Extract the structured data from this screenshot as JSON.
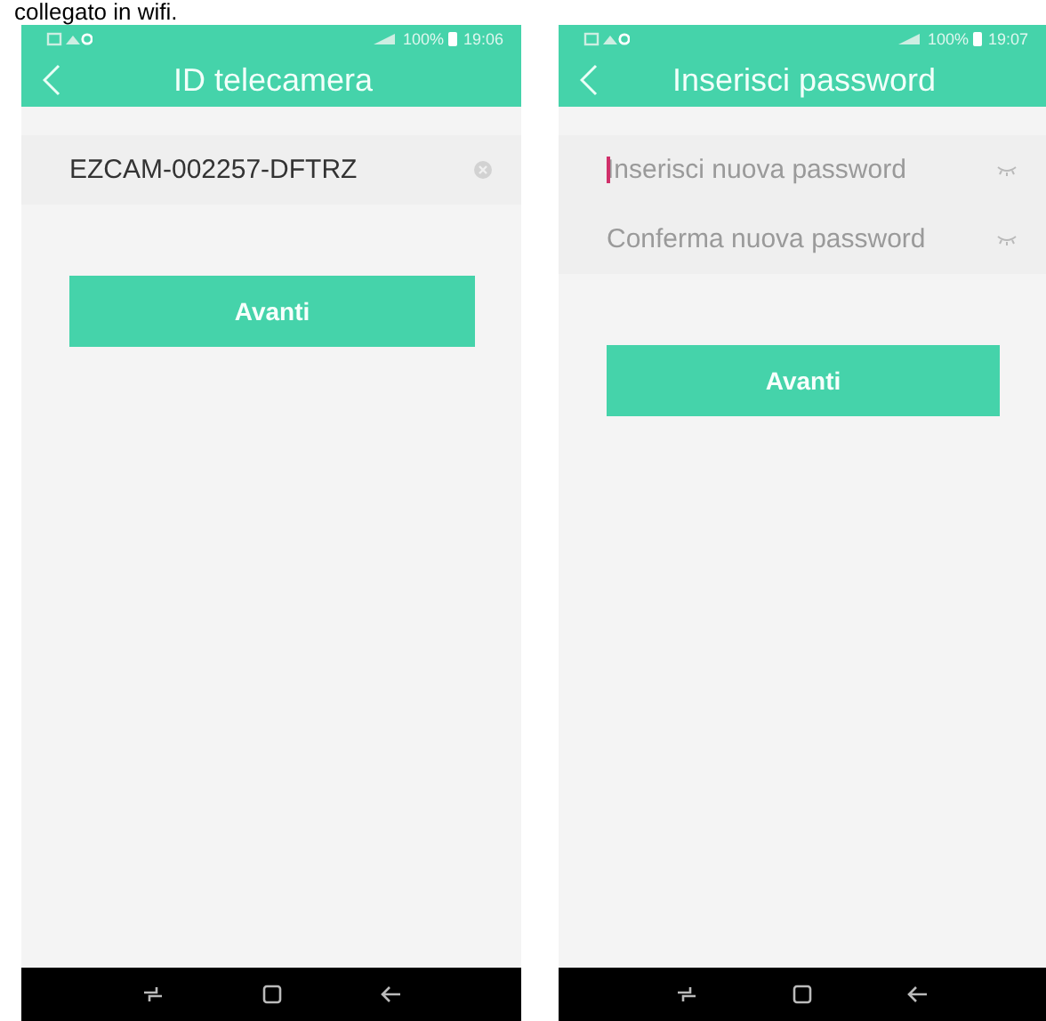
{
  "caption": "collegato in wifi.",
  "screens": [
    {
      "status": {
        "battery": "100%",
        "time": "19:06"
      },
      "title": "ID telecamera",
      "fields": [
        {
          "kind": "text",
          "value": "EZCAM-002257-DFTRZ",
          "focused": false
        }
      ],
      "button": "Avanti"
    },
    {
      "status": {
        "battery": "100%",
        "time": "19:07"
      },
      "title": "Inserisci password",
      "fields": [
        {
          "kind": "password",
          "placeholder": "Inserisci nuova password",
          "focused": true
        },
        {
          "kind": "password",
          "placeholder": "Conferma nuova password",
          "focused": false
        }
      ],
      "button": "Avanti"
    }
  ]
}
